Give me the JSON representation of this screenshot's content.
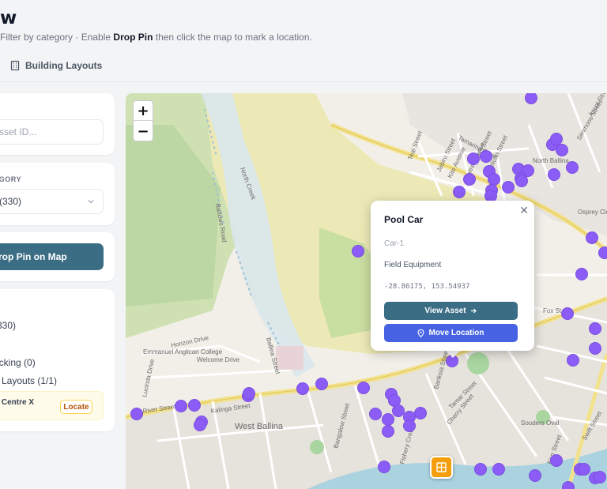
{
  "header": {
    "title": "w",
    "subtitle_prefix": "Filter by category · Enable ",
    "subtitle_bold": "Drop Pin",
    "subtitle_suffix": " then click the map to mark a location."
  },
  "tabs": [
    {
      "label": "Building Layouts",
      "icon": "building-icon"
    }
  ],
  "sidebar": {
    "search": {
      "placeholder": "sset ID..."
    },
    "category": {
      "label": "EGORY",
      "selected": "(330)"
    },
    "drop_pin": {
      "label": "rop Pin on Map"
    },
    "legend": {
      "items": [
        {
          "label": "(330)"
        },
        {
          "label": ")"
        },
        {
          "label": "acking (0)"
        },
        {
          "label": "g Layouts (1/1)"
        }
      ],
      "highlight": {
        "place": "g Centre X",
        "locate_label": "Locate"
      }
    }
  },
  "map": {
    "zoom_in": "+",
    "zoom_out": "−",
    "marker_color": "#8b5cf6",
    "building_marker_color": "#f59e0b",
    "street_labels": [
      "Tamarind Drive",
      "North Ballina",
      "Teal Street",
      "Simmons Street",
      "Ascot Street",
      "Jabiru Street",
      "Kite Avenue",
      "Kestrel Avenue",
      "Ibis Street",
      "Pelican Street",
      "Osprey Close",
      "Fox St",
      "Horizon Drive",
      "Welcome Drive",
      "Emmanuel Anglican College",
      "River Street",
      "Kalinga Street",
      "West Ballina",
      "Kerr Street",
      "Cherry Street",
      "Fishery Creek",
      "Swift Street",
      "Souders Oval",
      "Barlows Road",
      "Lucinda Drive",
      "Bangalow Street",
      "North Creek",
      "Tamar Street",
      "Ballina Street",
      "Banksia Street"
    ]
  },
  "popup": {
    "title": "Pool Car",
    "asset_id": "Car-1",
    "category": "Field Equipment",
    "coordinates": "-28.86175, 153.54937",
    "view_label": "View Asset",
    "move_label": "Move Location"
  }
}
